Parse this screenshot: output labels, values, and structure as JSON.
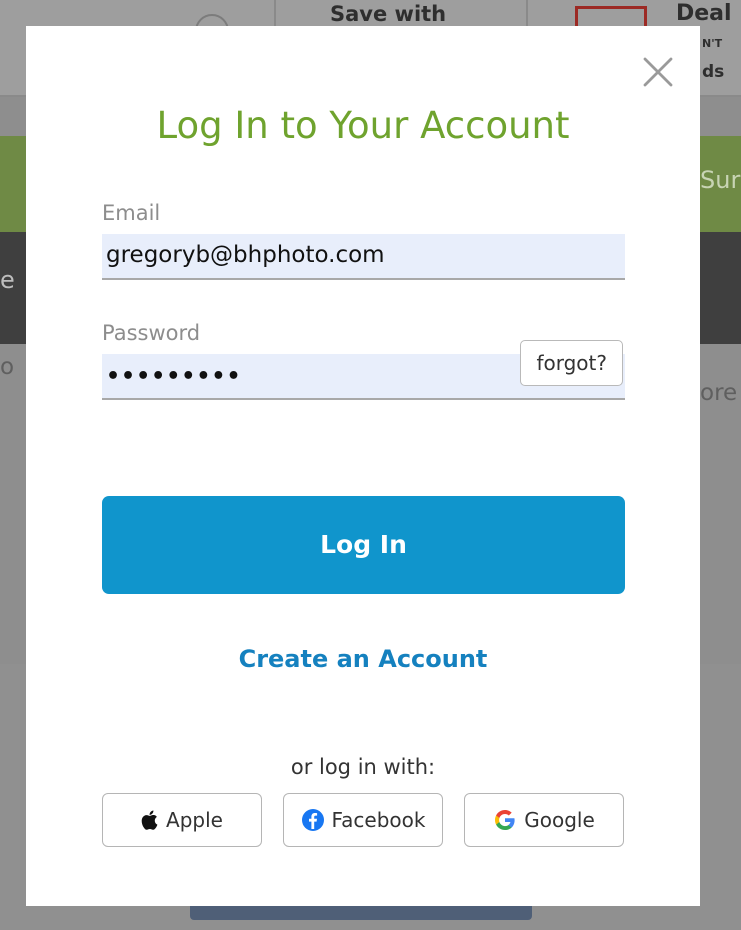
{
  "background": {
    "header_promo": "Save with",
    "deal_title": "Deal",
    "deal_subtitle": "N'T",
    "deal_ends": "ds",
    "green_band_text": "Sur",
    "dark_band_text": "e",
    "left_text": "o",
    "right_text": "ore"
  },
  "modal": {
    "title": "Log In to Your Account",
    "close_icon": "close-icon",
    "email": {
      "label": "Email",
      "value": "gregoryb@bhphoto.com"
    },
    "password": {
      "label": "Password",
      "masked_value": "•••••••••",
      "forgot_label": "forgot?"
    },
    "login_button": "Log In",
    "create_account": "Create an Account",
    "or_login_with": "or log in with:",
    "social": {
      "apple": {
        "label": "Apple",
        "icon": "apple-icon"
      },
      "facebook": {
        "label": "Facebook",
        "icon": "facebook-icon"
      },
      "google": {
        "label": "Google",
        "icon": "google-icon"
      }
    },
    "colors": {
      "title": "#6FA32E",
      "primary_button": "#1095CC",
      "link": "#1581BF",
      "input_background": "#E8EEFB"
    }
  }
}
